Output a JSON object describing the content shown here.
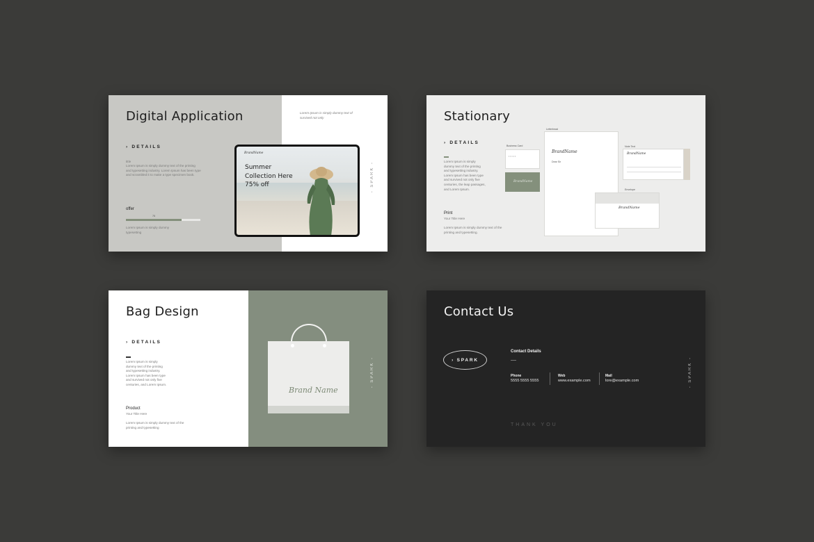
{
  "slide1": {
    "title": "Digital Application",
    "details": "› DETAILS",
    "intro_text": "Lorem Ipsum is simply dummy text of survived not only",
    "small_heading": "title",
    "body": "Lorem Ipsum is simply dummy text of the printing and typesetting industry. Lorem Ipsum has been type and scrambled it to make a type specimen book.",
    "offer_label": "offer",
    "offer_value": "75",
    "offer_progress": 0.75,
    "offer_note": "Lorem Ipsum is simply dummy typesetting",
    "tablet": {
      "brand": "BrandName",
      "promo_line1": "Summer",
      "promo_line2": "Collection Here",
      "promo_line3": "75% off"
    },
    "spark": "- SPARK -"
  },
  "slide2": {
    "title": "Stationary",
    "details": "› DETAILS",
    "body": "Lorem Ipsum is simply dummy text of the printing and typesetting industry. Lorem Ipsum has been type and survived not only five centuries, the leap passages, and Lorem Ipsum.",
    "print_label": "Print",
    "print_sub": "Your Title Here",
    "print_body": "Lorem Ipsum is simply dummy text of the printing and typesetting.",
    "letterhead_label": "Letterhead",
    "business_card_label": "Business Card",
    "note_label": "Note Text",
    "envelope_label": "Envelope",
    "brand": "BrandName",
    "dear": "Dear Sir"
  },
  "slide3": {
    "title": "Bag Design",
    "details": "› DETAILS",
    "body": "Lorem Ipsum is simply dummy text of the printing and typesetting industry. Lorem Ipsum has been type and survived not only five centuries, and Lorem Ipsum.",
    "product_label": "Product",
    "product_sub": "Your Title Here",
    "product_body": "Lorem Ipsum is simply dummy text of the printing and typesetting",
    "bag_brand": "Brand Name",
    "spark": "- SPARK -"
  },
  "slide4": {
    "title": "Contact Us",
    "spark_button": "› SPARK",
    "contact_heading": "Contact Details",
    "phone_label": "Phone",
    "phone_value": "5555 5555 5555",
    "web_label": "Web",
    "web_value": "www.example.com",
    "mail_label": "Mail",
    "mail_value": "lore@example.com",
    "thank_you": "THANK YOU",
    "spark": "- SPARK -"
  },
  "colors": {
    "background": "#3b3b39",
    "sage": "#848e7f",
    "light_gray": "#c8c8c4",
    "dark_slide": "#242424"
  }
}
